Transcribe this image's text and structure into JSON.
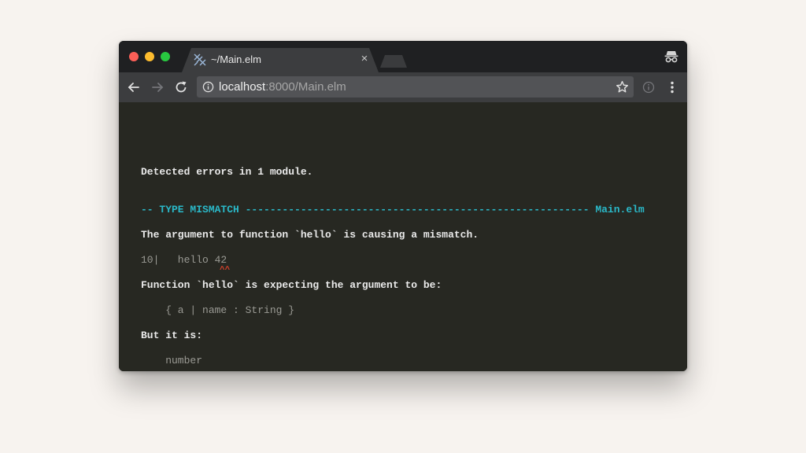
{
  "tab": {
    "title": "~/Main.elm",
    "close": "×"
  },
  "address": {
    "host": "localhost",
    "path": ":8000/Main.elm"
  },
  "error": {
    "summary": "Detected errors in 1 module.",
    "header_left": "-- TYPE MISMATCH ",
    "header_dashes": "-------------------------------------------------------- ",
    "header_file": "Main.elm",
    "message": "The argument to function `hello` is causing a mismatch.",
    "code_line_number": "10|",
    "code_text": "   hello ",
    "code_arg": "42",
    "code_caret": "^^",
    "expectation": "Function `hello` is expecting the argument to be:",
    "expected_type": "    { a | name : String }",
    "actual_intro": "But it is:",
    "actual_type": "    number"
  },
  "colors": {
    "page_background": "#f7f3ef",
    "content_background": "#272822",
    "header_accent": "#2ab8c8",
    "caret": "#d9412b"
  },
  "icons": [
    "elm-favicon-icon",
    "incognito-icon",
    "back-arrow-icon",
    "forward-arrow-icon",
    "reload-icon",
    "info-icon",
    "star-icon",
    "extension-info-icon",
    "more-vert-icon"
  ]
}
